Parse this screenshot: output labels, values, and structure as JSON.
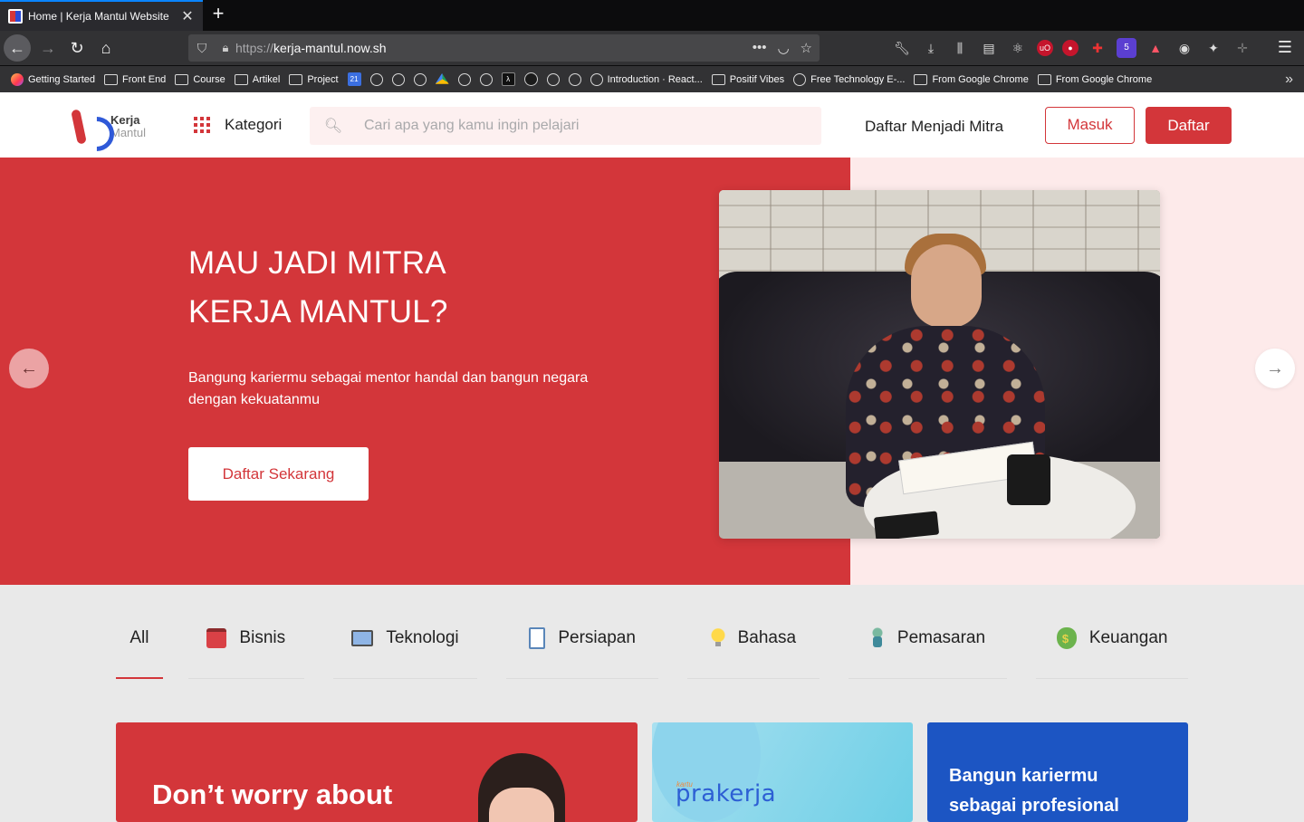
{
  "browser": {
    "tab_title": "Home | Kerja Mantul Website",
    "tab_close": "✕",
    "new_tab": "+",
    "url_protocol": "https://",
    "url_host": "kerja-mantul.now.sh",
    "ext_badge": "5",
    "bookmarks": [
      {
        "label": "Getting Started",
        "icon": "firefox-icon"
      },
      {
        "label": "Front End",
        "icon": "folder-icon"
      },
      {
        "label": "Course",
        "icon": "folder-icon"
      },
      {
        "label": "Artikel",
        "icon": "folder-icon"
      },
      {
        "label": "Project",
        "icon": "folder-icon"
      },
      {
        "label": "Introduction · React...",
        "icon": "globe-icon"
      },
      {
        "label": "Positif Vibes",
        "icon": "folder-icon"
      },
      {
        "label": "Free Technology E-...",
        "icon": "globe-icon"
      },
      {
        "label": "From Google Chrome",
        "icon": "folder-icon"
      },
      {
        "label": "From Google Chrome",
        "icon": "folder-icon"
      }
    ],
    "calendar_day": "21"
  },
  "header": {
    "logo_line1": "Kerja",
    "logo_line2": "Mantul",
    "kategori": "Kategori",
    "search_placeholder": "Cari apa yang kamu ingin pelajari",
    "mitra_link": "Daftar Menjadi Mitra",
    "login": "Masuk",
    "register": "Daftar"
  },
  "hero": {
    "title_line1": "MAU JADI MITRA",
    "title_line2": "KERJA MANTUL?",
    "subtitle": "Bangung kariermu sebagai mentor handal dan bangun negara dengan kekuatanmu",
    "cta": "Daftar Sekarang",
    "colors": {
      "primary": "#d3363a",
      "pink": "#fdeaea"
    }
  },
  "categories": [
    {
      "label": "All",
      "active": true
    },
    {
      "label": "Bisnis",
      "icon": "briefcase-icon"
    },
    {
      "label": "Teknologi",
      "icon": "monitor-icon"
    },
    {
      "label": "Persiapan",
      "icon": "clipboard-icon"
    },
    {
      "label": "Bahasa",
      "icon": "lightbulb-icon"
    },
    {
      "label": "Pemasaran",
      "icon": "person-icon"
    },
    {
      "label": "Keuangan",
      "icon": "money-bag-icon"
    }
  ],
  "cards": {
    "red_title": "Don’t worry about",
    "blue_small": "kartu",
    "blue_logo": "prakerja",
    "navy_title": "Bangun kariermu sebagai profesional"
  }
}
